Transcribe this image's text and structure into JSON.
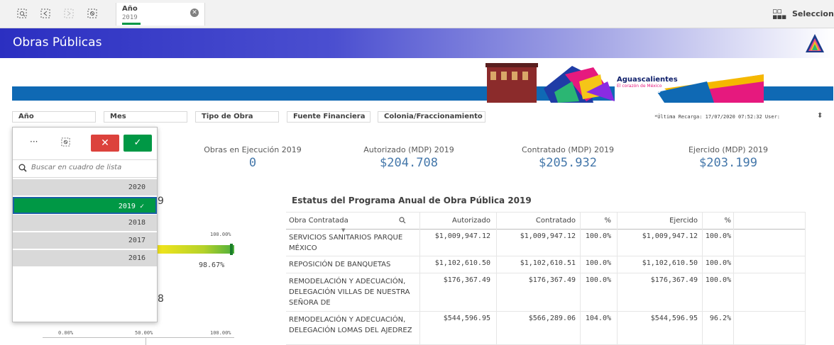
{
  "selection_bar": {
    "field": "Año",
    "value": "2019",
    "selections_label": "Selecciones"
  },
  "header": {
    "title": "Obras Públicas"
  },
  "filters": [
    "Año",
    "Mes",
    "Tipo de Obra",
    "Fuente Financiera",
    "Colonia/Fraccionamiento"
  ],
  "last_reload": "*Última Recarga: 17/07/2020 07:52:32 User:",
  "kpis": [
    {
      "label": "Obras en Ejecución 2019",
      "value": "0"
    },
    {
      "label": "Autorizado (MDP) 2019",
      "value": "$204.708"
    },
    {
      "label": "Contratado (MDP) 2019",
      "value": "$205.932"
    },
    {
      "label": "Ejercido (MDP) 2019",
      "value": "$203.199"
    }
  ],
  "listbox": {
    "more": "···",
    "search_placeholder": "Buscar en cuadro de lista",
    "options": [
      "2020",
      "2019 ✓",
      "2018",
      "2017",
      "2016"
    ],
    "selected_index": 1
  },
  "left_chart": {
    "fragment_top": "9",
    "fragment_mid": "8",
    "axis_top_label": "100.00%",
    "percent": "98.67%",
    "axis_labels": [
      "0.00%",
      "50.00%",
      "100.00%"
    ],
    "gauge_fraction": 0.9867
  },
  "table": {
    "title": "Estatus del Programa Anual de Obra Pública 2019",
    "headers": [
      "Obra Contratada",
      "Autorizado",
      "Contratado",
      "%",
      "Ejercido",
      "%"
    ],
    "rows": [
      [
        "SERVICIOS SANITARIOS PARQUE MÉXICO",
        "$1,009,947.12",
        "$1,009,947.12",
        "100.0%",
        "$1,009,947.12",
        "100.0%"
      ],
      [
        "REPOSICIÓN DE BANQUETAS",
        "$1,102,610.50",
        "$1,102,610.51",
        "100.0%",
        "$1,102,610.50",
        "100.0%"
      ],
      [
        "REMODELACIÓN Y ADECUACIÓN, DELEGACIÓN VILLAS DE NUESTRA SEÑORA DE",
        "$176,367.49",
        "$176,367.49",
        "100.0%",
        "$176,367.49",
        "100.0%"
      ],
      [
        "REMODELACIÓN Y ADECUACIÓN, DELEGACIÓN LOMAS DEL AJEDREZ",
        "$544,596.95",
        "$566,289.06",
        "104.0%",
        "$544,596.95",
        "96.2%"
      ]
    ]
  },
  "colors": {
    "header_start": "#2b2fc1",
    "banner": "#0f69b4",
    "kpi_value": "#4477aa",
    "selected": "#009845",
    "cancel": "#dc423c"
  },
  "logo_text": {
    "line1": "Aguascalientes",
    "line2": "El corazón de México",
    "line3": "AYUNTAMIENTO"
  }
}
